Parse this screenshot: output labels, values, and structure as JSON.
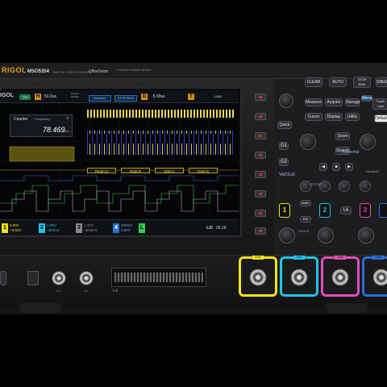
{
  "header": {
    "brand": "RIGOL",
    "model": "MSO5354",
    "model_sub": "DIGITAL OSCILLOSCOPE",
    "ultra_vision": "UltraVision",
    "model_label": "4 Channel 350MHz 8GSa/s"
  },
  "screen": {
    "logo": "IGOL",
    "trigger_status": "T'D",
    "horizontal": {
      "badge": "H",
      "value": "50.0us",
      "sample_rate": "8GSa/s",
      "memory": "10Mpts"
    },
    "measure_label": "Measure",
    "run_state": "STOP/RUN",
    "delay": {
      "badge": "D",
      "value": "-5.00us"
    },
    "trigger": {
      "badge": "T",
      "level": "1.68V"
    },
    "counter": {
      "title": "Counter",
      "mode": "Frequency",
      "close": "✕",
      "value": "78.469",
      "unit": "kHz"
    },
    "bus_decode": [
      "Read:12",
      "Data:R",
      "Data:1",
      "Data:G"
    ],
    "channels": [
      {
        "num": "1",
        "scale": "2.00V",
        "offset": "+3.62V",
        "color": "#f5e21a"
      },
      {
        "num": "2",
        "scale": "2.00V",
        "offset": "-400mV",
        "color": "#1fc4e8"
      },
      {
        "num": "3",
        "scale": "1.32V",
        "offset": "+533mV",
        "color": "#e04db8"
      },
      {
        "num": "4",
        "scale": "160mV",
        "offset": "0.00V",
        "color": "#2a6fd6"
      }
    ],
    "la": {
      "badge": "L",
      "label": "LA"
    },
    "time": "05:18",
    "lxi": "LXI"
  },
  "panel": {
    "buttons": {
      "clear": "CLEAR",
      "auto": "AUTO",
      "stop": "STOP RUN",
      "single": "SINGLE",
      "measure": "Measure",
      "acquire": "Acquire",
      "storage": "Storage",
      "menu": "Menu",
      "touch_lock": "Touch Lock",
      "cursor": "Cursor",
      "display": "Display",
      "utility": "Utility",
      "default": "Default",
      "quick": "Quick",
      "zoom": "Zoom",
      "search": "Search",
      "math": "Math",
      "ref": "Ref",
      "la": "LA"
    },
    "section_labels": {
      "horizontal": "Horizontal",
      "vertical": "Vertical",
      "navigate": "Navigate",
      "offset": "OFFSET",
      "scale": "SCALE"
    }
  },
  "front": {
    "la_label": "LA",
    "probe_labels": [
      "CH1",
      "CH2",
      "CH3",
      "CH4"
    ],
    "gen_labels": [
      "G1",
      "G2"
    ]
  },
  "colors": {
    "ch1": "#f5e21a",
    "ch2": "#1fc4e8",
    "ch3": "#e04db8",
    "ch4": "#2a6fd6",
    "digital": "#33cc55",
    "accent": "#d88a1a"
  }
}
